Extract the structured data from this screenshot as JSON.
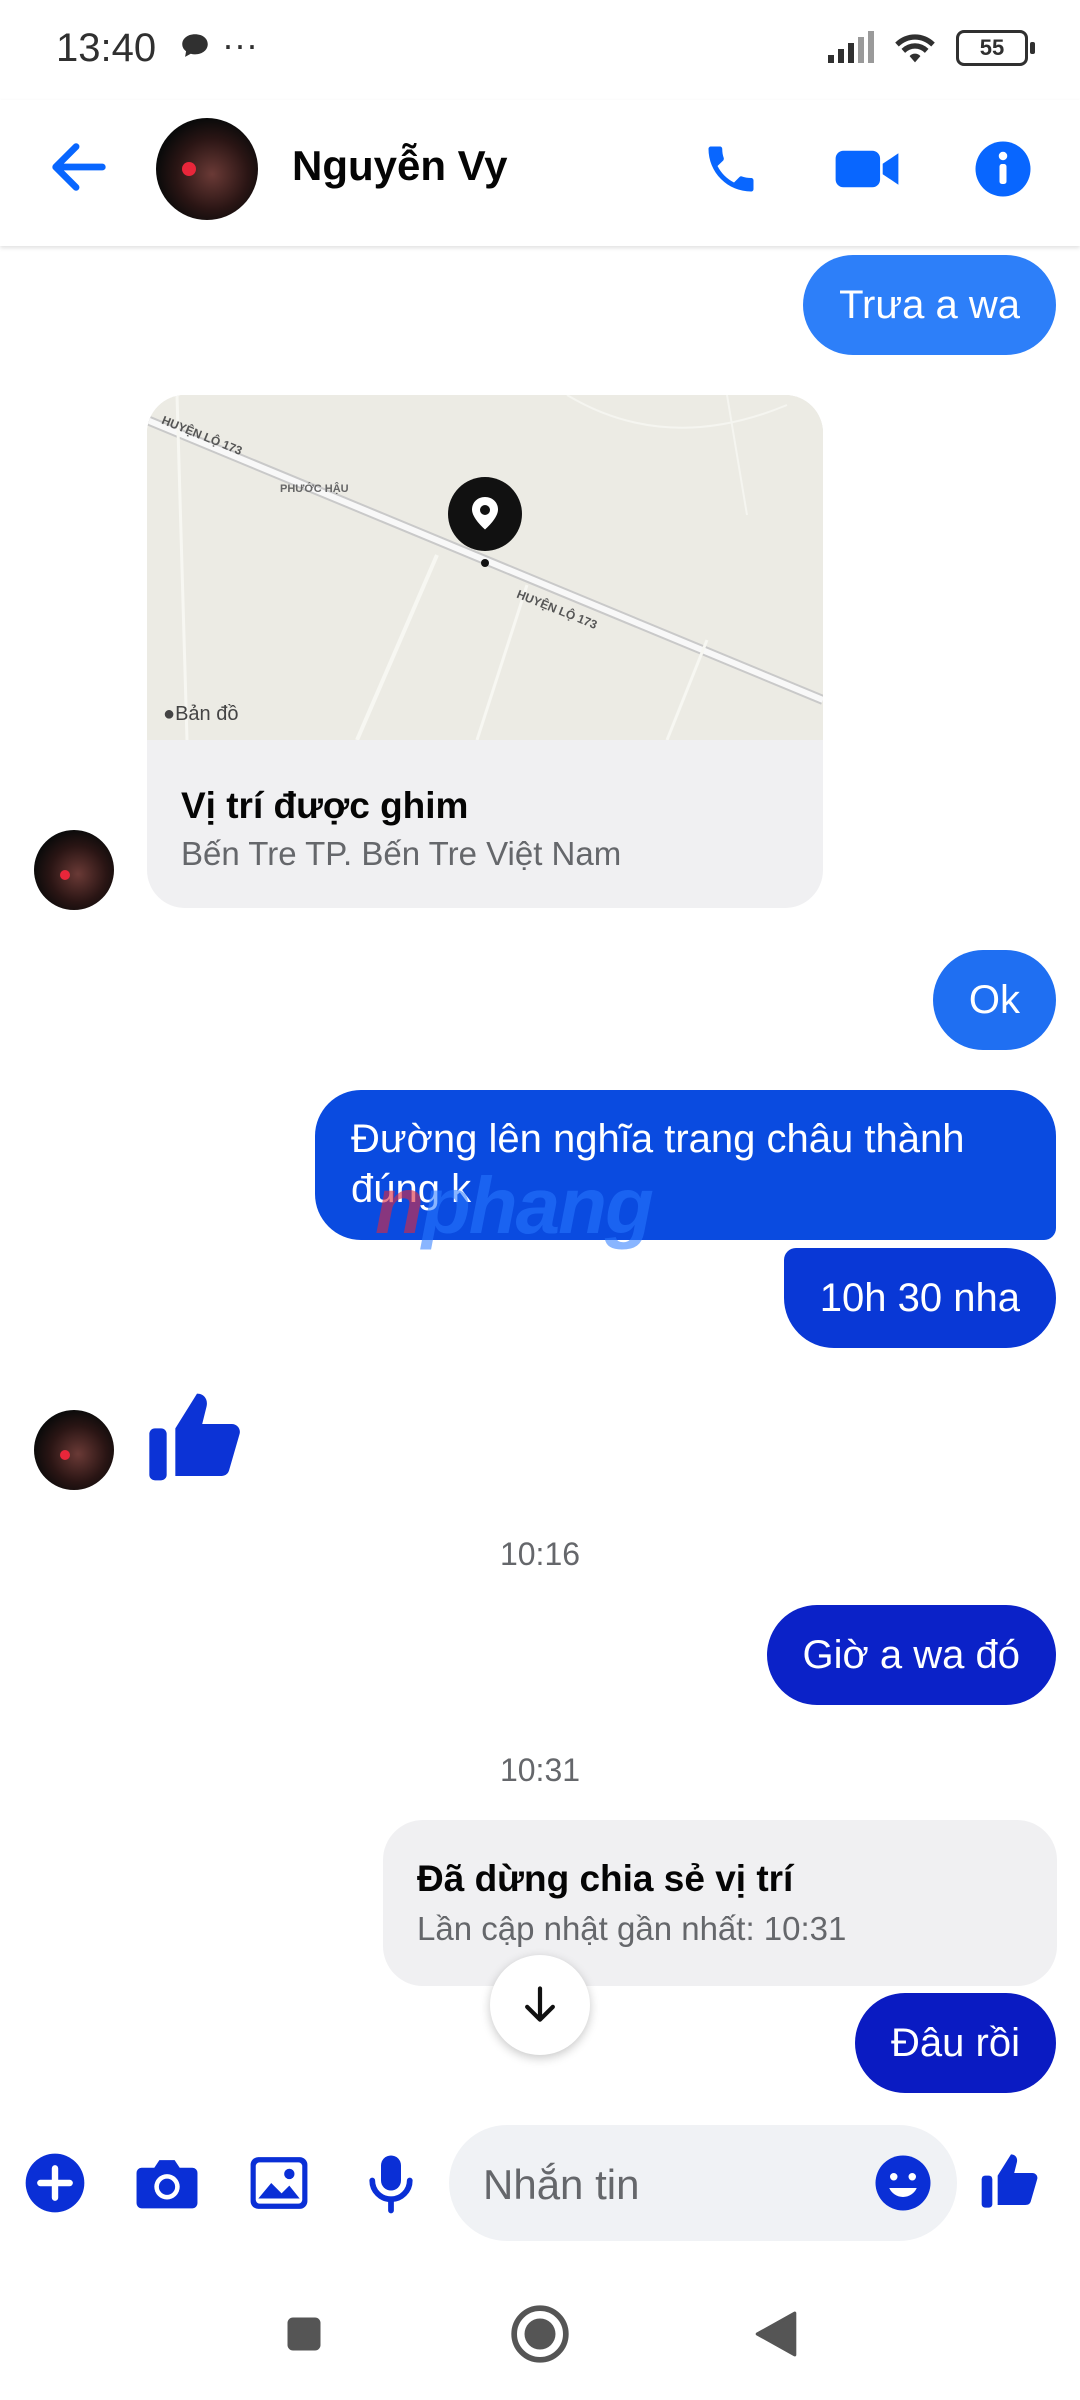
{
  "status_bar": {
    "time": "13:40",
    "dots": "···",
    "battery": "55"
  },
  "header": {
    "contact_name": "Nguyễn Vy"
  },
  "messages": {
    "m1": "Trưa a wa",
    "map": {
      "title": "Vị trí được ghim",
      "subtitle": "Bến Tre TP. Bến Tre Việt Nam",
      "road_label_1": "HUYỆN LỘ 173",
      "road_label_2": "HUYỆN LỘ 173",
      "place_label": "PHƯỚC HẬU",
      "attribution": "Bản đồ"
    },
    "m2": "Ok",
    "m3_line1": "Đường lên nghĩa trang châu thành",
    "m3_line2": "đúng k",
    "m4": "10h 30 nha",
    "time1": "10:16",
    "m5": "Giờ a wa đó",
    "time2": "10:31",
    "share": {
      "title": "Đã dừng chia sẻ vị trí",
      "subtitle": "Lần cập nhật gần nhất: 10:31"
    },
    "m6": "Đâu rồi"
  },
  "composer": {
    "placeholder": "Nhắn tin"
  },
  "watermark": {
    "part1": "n",
    "part2": "phang"
  },
  "colors": {
    "accent": "#0866ff",
    "bubble_light": "#2d7ff9",
    "bubble_mid": "#0a4be0",
    "bubble_dark": "#0b22c8"
  }
}
